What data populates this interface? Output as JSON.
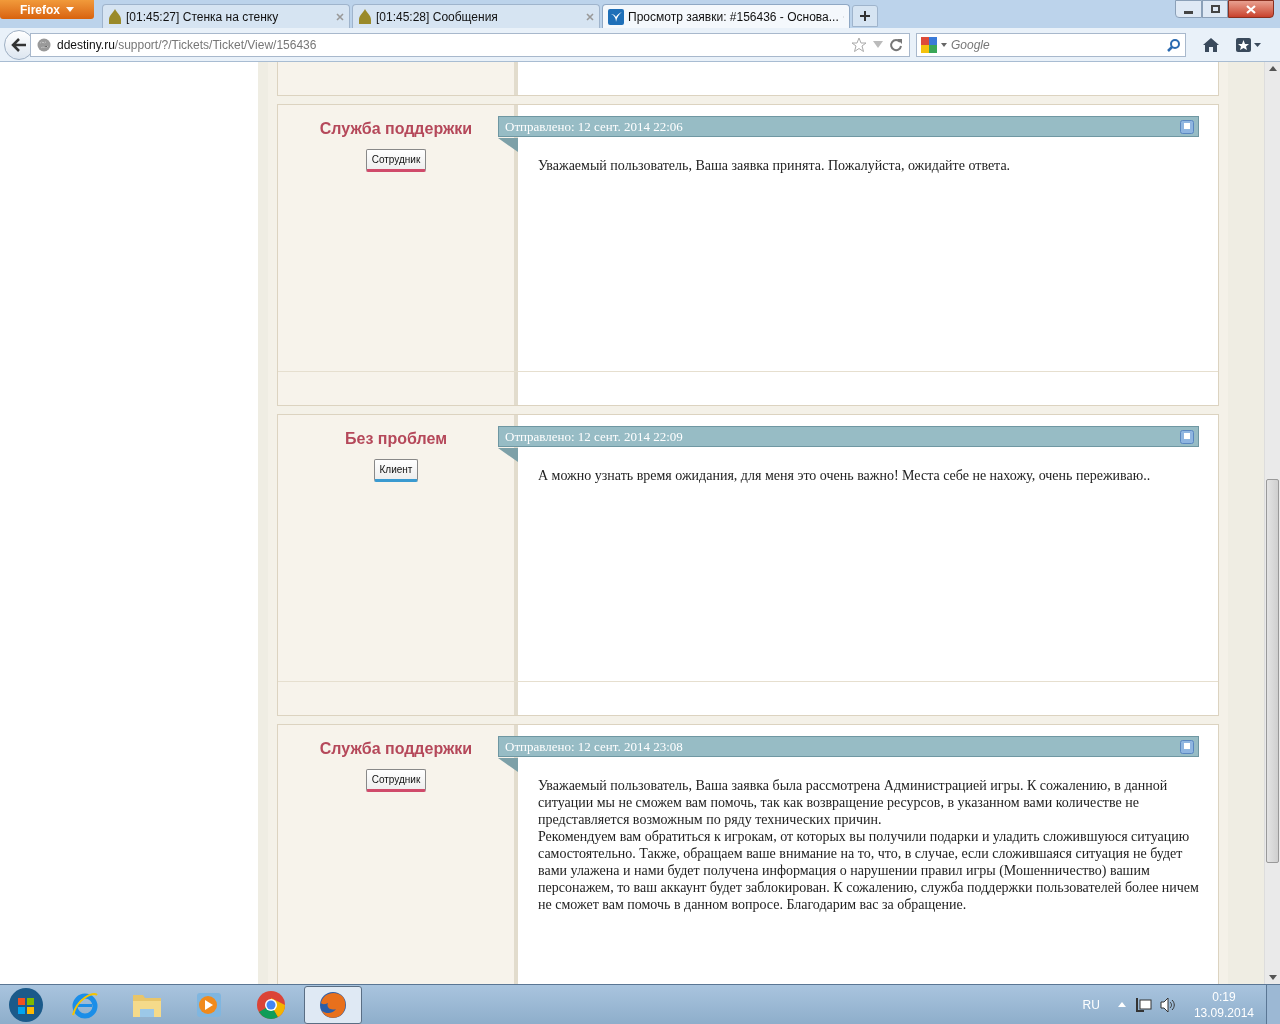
{
  "browser": {
    "menu_button": "Firefox",
    "tabs": [
      {
        "title": "[01:45:27] Стенка на стенку",
        "selected": false,
        "kind": "dome"
      },
      {
        "title": "[01:45:28] Сообщения",
        "selected": false,
        "kind": "dome"
      },
      {
        "title": "Просмотр заявки: #156436 - Основа...",
        "selected": true,
        "kind": "bird"
      }
    ],
    "url_host": "ddestiny.ru",
    "url_path": "/support/?/Tickets/Ticket/View/156436",
    "search_placeholder": "Google"
  },
  "posts": [
    {
      "author": "Служба поддержки",
      "role": "Сотрудник",
      "kind": "staff",
      "sent": "Отправлено: 12 сент. 2014 22:06",
      "body": [
        "Уважаемый пользователь, Ваша заявка принята. Пожалуйста, ожидайте ответа."
      ]
    },
    {
      "author": "Без проблем",
      "role": "Клиент",
      "kind": "client",
      "sent": "Отправлено: 12 сент. 2014 22:09",
      "body": [
        "А можно узнать время ожидания, для меня это очень важно! Места себе не нахожу, очень переживаю.."
      ]
    },
    {
      "author": "Служба поддержки",
      "role": "Сотрудник",
      "kind": "staff",
      "sent": "Отправлено: 12 сент. 2014 23:08",
      "body": [
        "Уважаемый пользователь, Ваша заявка была рассмотрена Администрацией игры. К сожалению, в данной ситуации мы не сможем вам помочь, так как возвращение ресурсов, в указанном вами количестве не представляется возможным по ряду технических причин.",
        "Рекомендуем вам обратиться к игрокам, от которых вы получили подарки и уладить сложившуюся ситуацию самостоятельно. Также, обращаем ваше внимание на то, что, в случае, если сложившаяся ситуация не будет вами улажена и нами будет получена информация о нарушении правил игры (Мошенничество) вашим персонажем, то ваш аккаунт будет заблокирован. К сожалению, служба поддержки пользователей более ничем не сможет вам помочь в данном вопросе. Благодарим вас за обращение."
      ]
    }
  ],
  "taskbar": {
    "apps": [
      {
        "kind": "ie",
        "selected": false
      },
      {
        "kind": "explorer",
        "selected": false
      },
      {
        "kind": "media",
        "selected": false
      },
      {
        "kind": "chrome",
        "selected": false
      },
      {
        "kind": "firefox",
        "selected": true
      }
    ],
    "language": "RU",
    "time": "0:19",
    "date": "13.09.2014"
  }
}
